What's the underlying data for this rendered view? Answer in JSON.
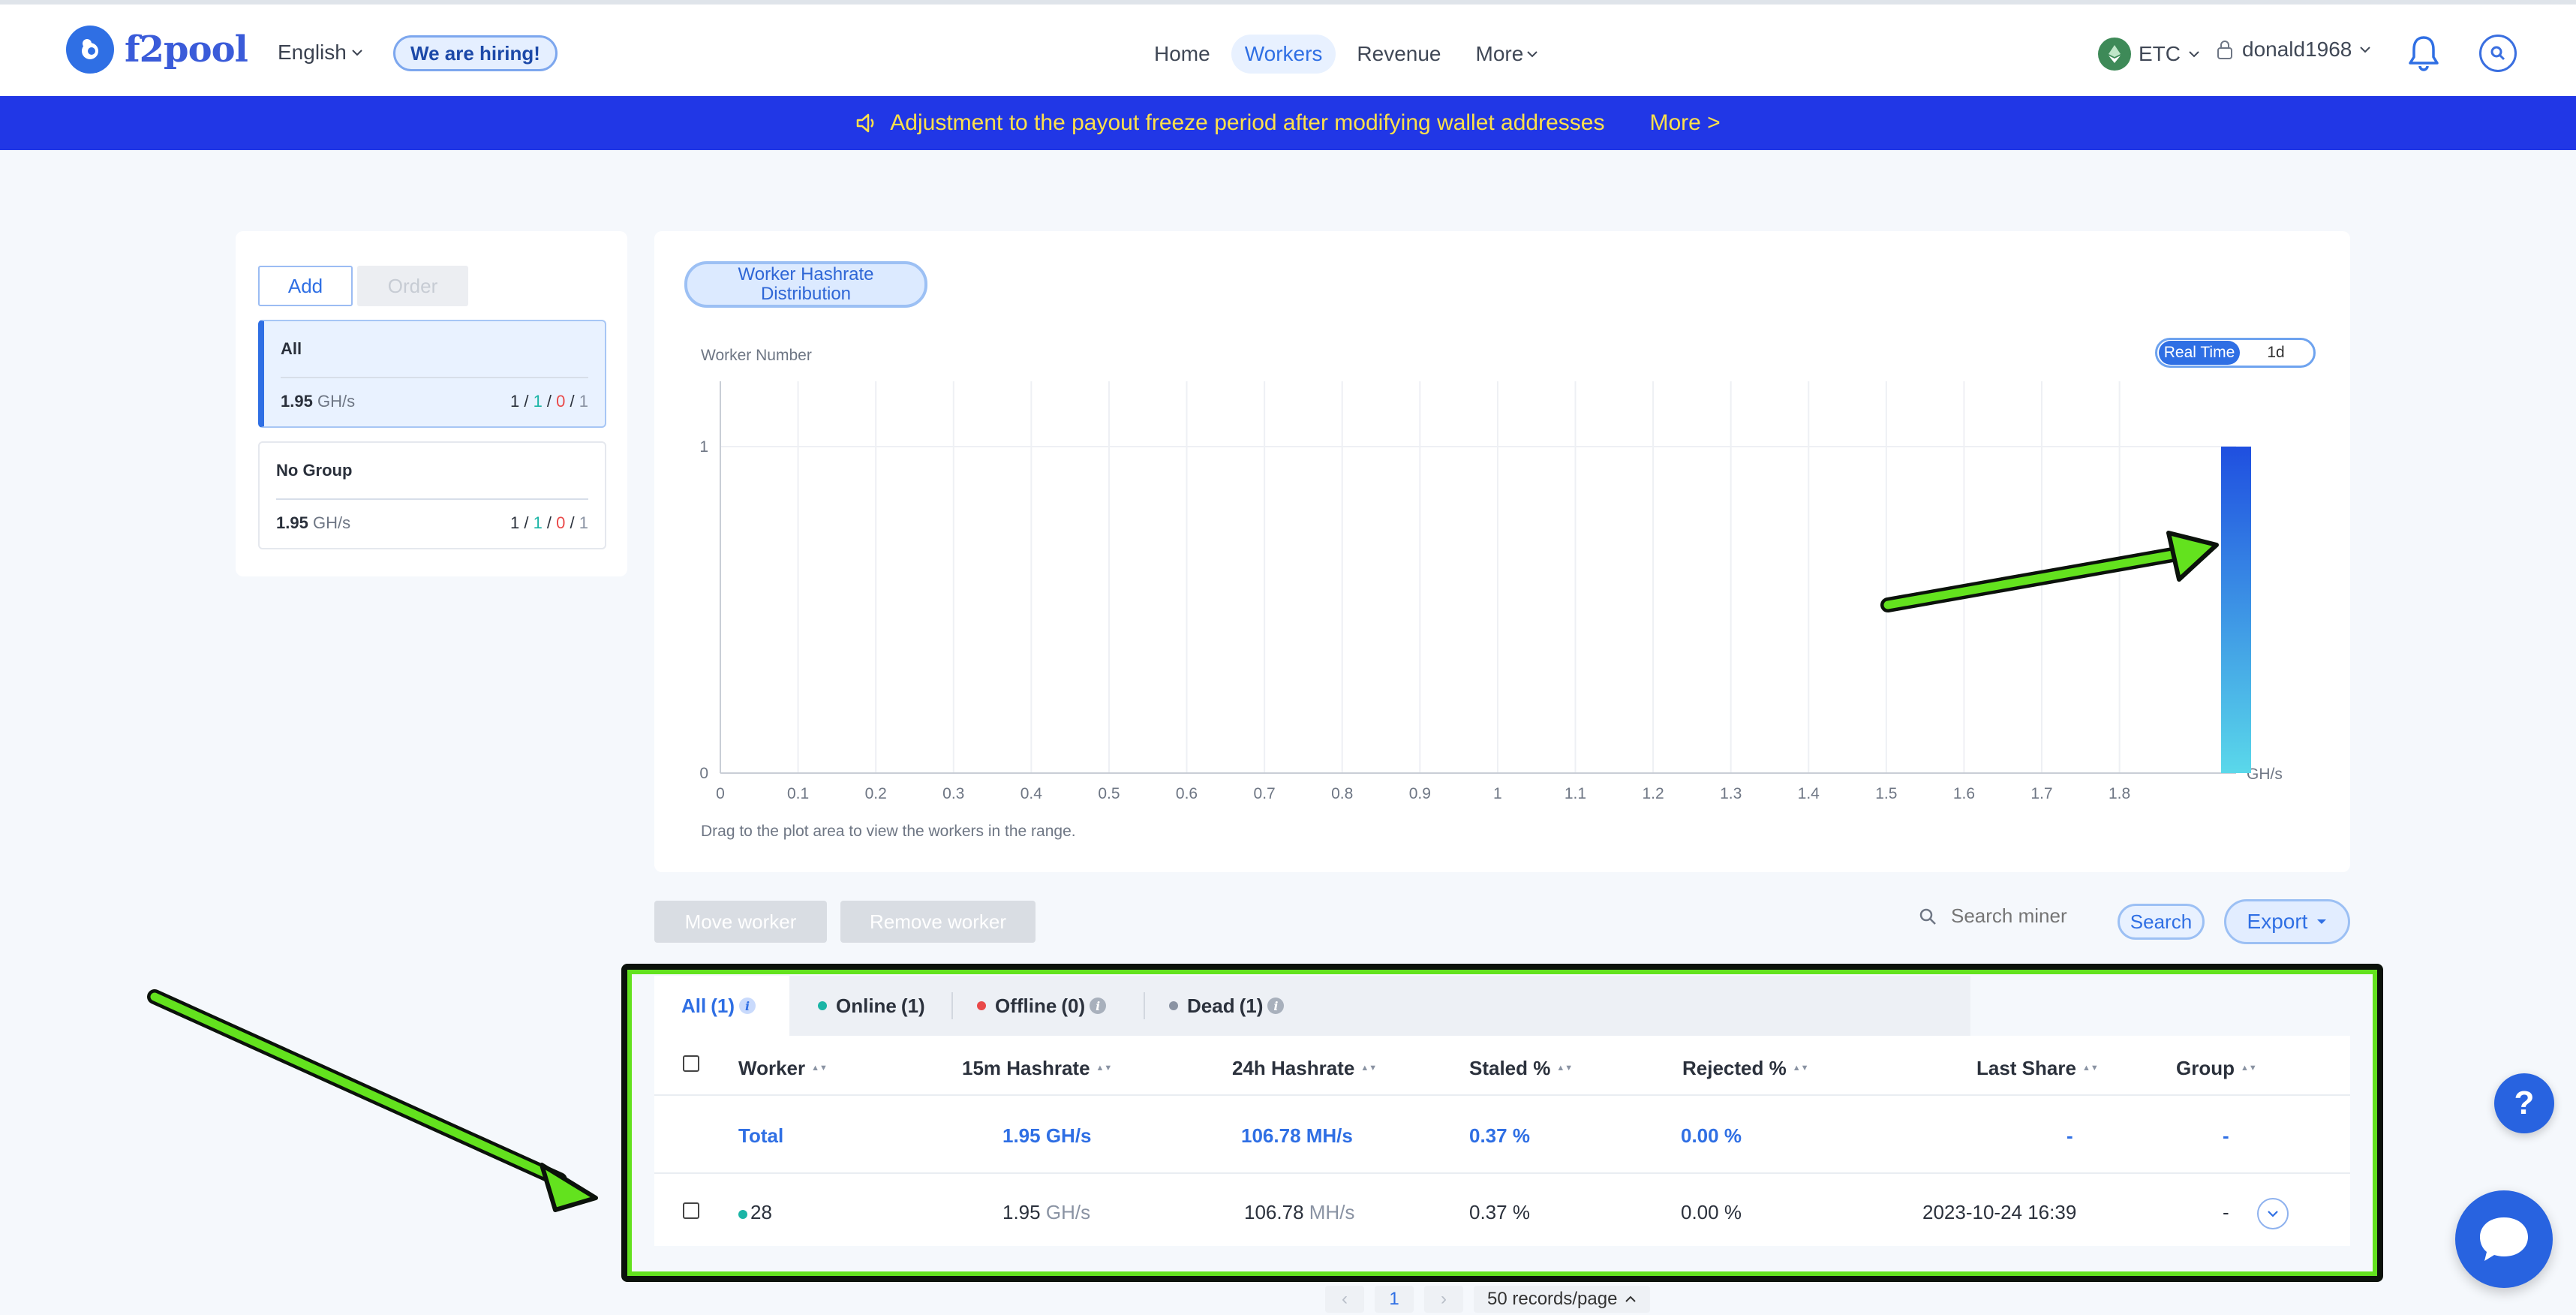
{
  "header": {
    "logo_text": "f2pool",
    "language": "English",
    "hiring": "We are hiring!",
    "nav": [
      {
        "label": "Home"
      },
      {
        "label": "Workers"
      },
      {
        "label": "Revenue"
      },
      {
        "label": "More"
      }
    ],
    "coin": "ETC",
    "username": "donald1968"
  },
  "banner": {
    "text": "Adjustment to the payout freeze period after modifying wallet addresses",
    "more": "More >"
  },
  "groups": {
    "add_label": "Add",
    "order_label": "Order",
    "items": [
      {
        "name": "All",
        "rate_value": "1.95",
        "rate_unit": "GH/s",
        "total": "1",
        "online": "1",
        "offline": "0",
        "dead": "1"
      },
      {
        "name": "No Group",
        "rate_value": "1.95",
        "rate_unit": "GH/s",
        "total": "1",
        "online": "1",
        "offline": "0",
        "dead": "1"
      }
    ]
  },
  "chart": {
    "tab_label_line1": "Worker Hashrate",
    "tab_label_line2": "Distribution",
    "toggle": {
      "active": "Real Time",
      "inactive": "1d"
    },
    "hint": "Drag to the plot area to view the workers in the range."
  },
  "chart_data": {
    "type": "bar",
    "title": "",
    "xlabel": "GH/s",
    "ylabel": "Worker Number",
    "xlim": [
      0,
      1.95
    ],
    "ylim": [
      0,
      1.2
    ],
    "x_ticks": [
      "0",
      "0.1",
      "0.2",
      "0.3",
      "0.4",
      "0.5",
      "0.6",
      "0.7",
      "0.8",
      "0.9",
      "1",
      "1.1",
      "1.2",
      "1.3",
      "1.4",
      "1.5",
      "1.6",
      "1.7",
      "1.8"
    ],
    "y_ticks": [
      "0",
      "1"
    ],
    "bars": [
      {
        "x": 1.95,
        "value": 1
      }
    ],
    "grid": true,
    "colors": {
      "bar_top": "#1f4fe0",
      "bar_bottom": "#5ad8ea",
      "grid": "#eef0f4",
      "axis": "#c9ced6"
    }
  },
  "actions": {
    "move_worker": "Move worker",
    "remove_worker": "Remove worker",
    "search_placeholder": "Search miner",
    "search_button": "Search",
    "export": "Export"
  },
  "table": {
    "tabs": [
      {
        "label": "All",
        "count": "(1)"
      },
      {
        "label": "Online",
        "count": "(1)"
      },
      {
        "label": "Offline",
        "count": "(0)"
      },
      {
        "label": "Dead",
        "count": "(1)"
      }
    ],
    "columns": [
      "Worker",
      "15m Hashrate",
      "24h Hashrate",
      "Staled %",
      "Rejected %",
      "Last Share",
      "Group"
    ],
    "total": {
      "label": "Total",
      "h15": "1.95 GH/s",
      "h24": "106.78 MH/s",
      "staled": "0.37 %",
      "rejected": "0.00 %",
      "last_share": "-",
      "group": "-"
    },
    "rows": [
      {
        "worker": "28",
        "h15_value": "1.95",
        "h15_unit": "GH/s",
        "h24_value": "106.78",
        "h24_unit": "MH/s",
        "staled": "0.37 %",
        "rejected": "0.00 %",
        "last_share": "2023-10-24 16:39",
        "group": "-"
      }
    ]
  },
  "pagination": {
    "page": "1",
    "page_size": "50 records/page"
  },
  "floating": {
    "help": "?"
  }
}
